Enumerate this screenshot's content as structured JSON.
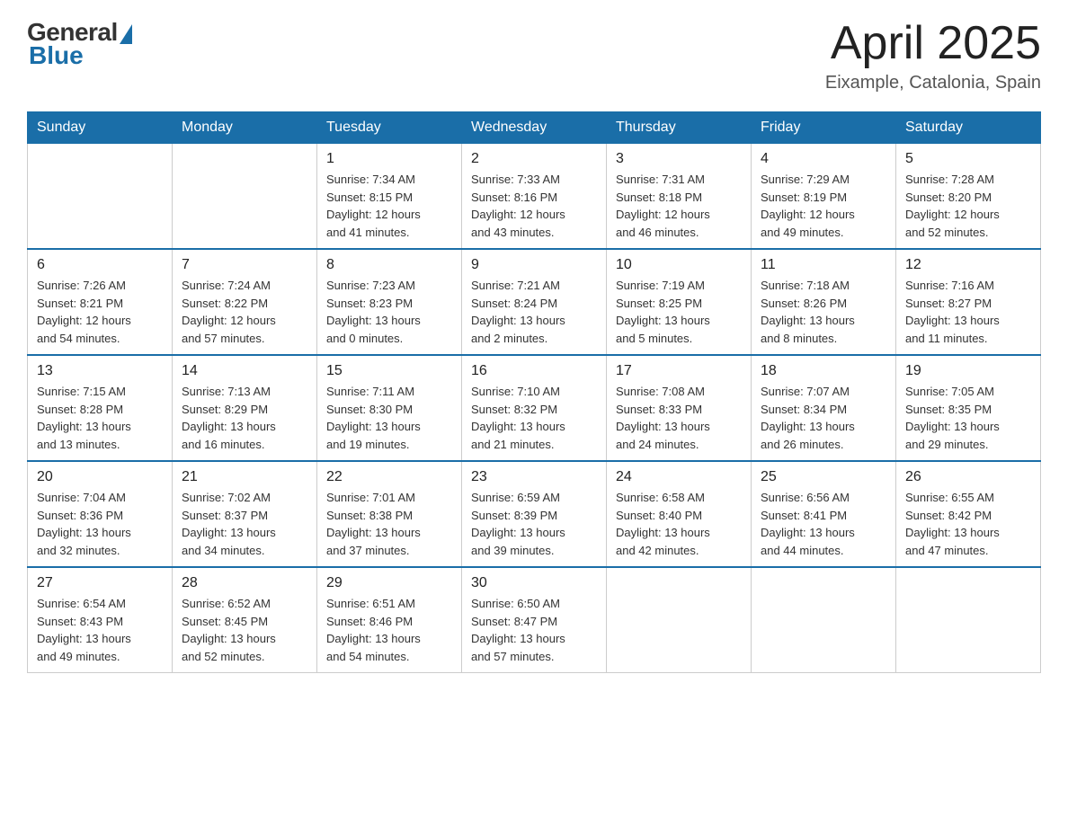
{
  "header": {
    "logo_general": "General",
    "logo_blue": "Blue",
    "month_title": "April 2025",
    "subtitle": "Eixample, Catalonia, Spain"
  },
  "weekdays": [
    "Sunday",
    "Monday",
    "Tuesday",
    "Wednesday",
    "Thursday",
    "Friday",
    "Saturday"
  ],
  "weeks": [
    [
      {
        "day": "",
        "info": ""
      },
      {
        "day": "",
        "info": ""
      },
      {
        "day": "1",
        "info": "Sunrise: 7:34 AM\nSunset: 8:15 PM\nDaylight: 12 hours\nand 41 minutes."
      },
      {
        "day": "2",
        "info": "Sunrise: 7:33 AM\nSunset: 8:16 PM\nDaylight: 12 hours\nand 43 minutes."
      },
      {
        "day": "3",
        "info": "Sunrise: 7:31 AM\nSunset: 8:18 PM\nDaylight: 12 hours\nand 46 minutes."
      },
      {
        "day": "4",
        "info": "Sunrise: 7:29 AM\nSunset: 8:19 PM\nDaylight: 12 hours\nand 49 minutes."
      },
      {
        "day": "5",
        "info": "Sunrise: 7:28 AM\nSunset: 8:20 PM\nDaylight: 12 hours\nand 52 minutes."
      }
    ],
    [
      {
        "day": "6",
        "info": "Sunrise: 7:26 AM\nSunset: 8:21 PM\nDaylight: 12 hours\nand 54 minutes."
      },
      {
        "day": "7",
        "info": "Sunrise: 7:24 AM\nSunset: 8:22 PM\nDaylight: 12 hours\nand 57 minutes."
      },
      {
        "day": "8",
        "info": "Sunrise: 7:23 AM\nSunset: 8:23 PM\nDaylight: 13 hours\nand 0 minutes."
      },
      {
        "day": "9",
        "info": "Sunrise: 7:21 AM\nSunset: 8:24 PM\nDaylight: 13 hours\nand 2 minutes."
      },
      {
        "day": "10",
        "info": "Sunrise: 7:19 AM\nSunset: 8:25 PM\nDaylight: 13 hours\nand 5 minutes."
      },
      {
        "day": "11",
        "info": "Sunrise: 7:18 AM\nSunset: 8:26 PM\nDaylight: 13 hours\nand 8 minutes."
      },
      {
        "day": "12",
        "info": "Sunrise: 7:16 AM\nSunset: 8:27 PM\nDaylight: 13 hours\nand 11 minutes."
      }
    ],
    [
      {
        "day": "13",
        "info": "Sunrise: 7:15 AM\nSunset: 8:28 PM\nDaylight: 13 hours\nand 13 minutes."
      },
      {
        "day": "14",
        "info": "Sunrise: 7:13 AM\nSunset: 8:29 PM\nDaylight: 13 hours\nand 16 minutes."
      },
      {
        "day": "15",
        "info": "Sunrise: 7:11 AM\nSunset: 8:30 PM\nDaylight: 13 hours\nand 19 minutes."
      },
      {
        "day": "16",
        "info": "Sunrise: 7:10 AM\nSunset: 8:32 PM\nDaylight: 13 hours\nand 21 minutes."
      },
      {
        "day": "17",
        "info": "Sunrise: 7:08 AM\nSunset: 8:33 PM\nDaylight: 13 hours\nand 24 minutes."
      },
      {
        "day": "18",
        "info": "Sunrise: 7:07 AM\nSunset: 8:34 PM\nDaylight: 13 hours\nand 26 minutes."
      },
      {
        "day": "19",
        "info": "Sunrise: 7:05 AM\nSunset: 8:35 PM\nDaylight: 13 hours\nand 29 minutes."
      }
    ],
    [
      {
        "day": "20",
        "info": "Sunrise: 7:04 AM\nSunset: 8:36 PM\nDaylight: 13 hours\nand 32 minutes."
      },
      {
        "day": "21",
        "info": "Sunrise: 7:02 AM\nSunset: 8:37 PM\nDaylight: 13 hours\nand 34 minutes."
      },
      {
        "day": "22",
        "info": "Sunrise: 7:01 AM\nSunset: 8:38 PM\nDaylight: 13 hours\nand 37 minutes."
      },
      {
        "day": "23",
        "info": "Sunrise: 6:59 AM\nSunset: 8:39 PM\nDaylight: 13 hours\nand 39 minutes."
      },
      {
        "day": "24",
        "info": "Sunrise: 6:58 AM\nSunset: 8:40 PM\nDaylight: 13 hours\nand 42 minutes."
      },
      {
        "day": "25",
        "info": "Sunrise: 6:56 AM\nSunset: 8:41 PM\nDaylight: 13 hours\nand 44 minutes."
      },
      {
        "day": "26",
        "info": "Sunrise: 6:55 AM\nSunset: 8:42 PM\nDaylight: 13 hours\nand 47 minutes."
      }
    ],
    [
      {
        "day": "27",
        "info": "Sunrise: 6:54 AM\nSunset: 8:43 PM\nDaylight: 13 hours\nand 49 minutes."
      },
      {
        "day": "28",
        "info": "Sunrise: 6:52 AM\nSunset: 8:45 PM\nDaylight: 13 hours\nand 52 minutes."
      },
      {
        "day": "29",
        "info": "Sunrise: 6:51 AM\nSunset: 8:46 PM\nDaylight: 13 hours\nand 54 minutes."
      },
      {
        "day": "30",
        "info": "Sunrise: 6:50 AM\nSunset: 8:47 PM\nDaylight: 13 hours\nand 57 minutes."
      },
      {
        "day": "",
        "info": ""
      },
      {
        "day": "",
        "info": ""
      },
      {
        "day": "",
        "info": ""
      }
    ]
  ]
}
